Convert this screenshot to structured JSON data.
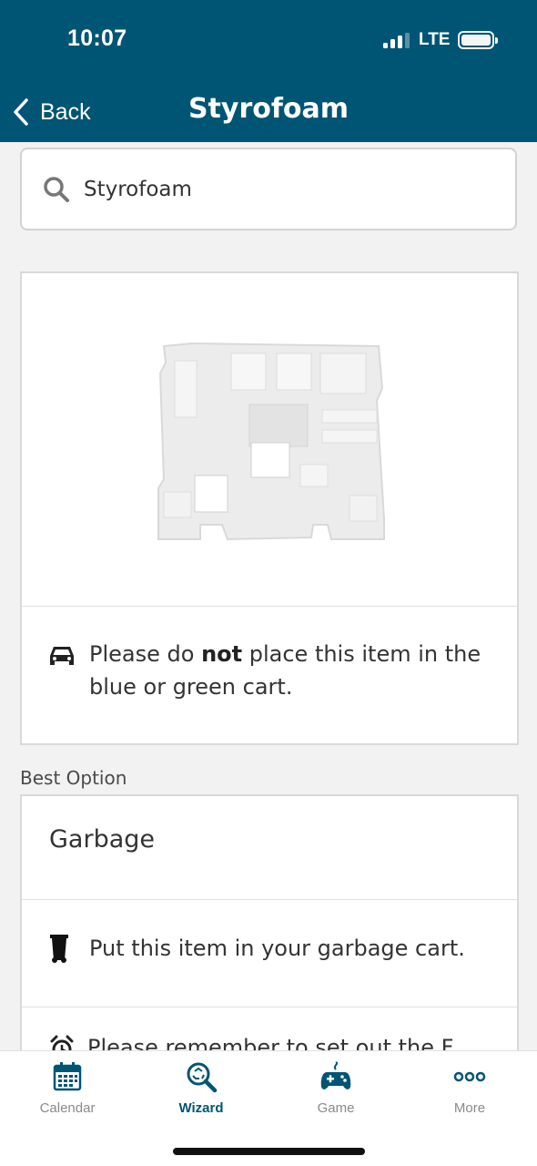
{
  "status_bar": {
    "time": "10:07",
    "network": "LTE"
  },
  "header": {
    "back_label": "Back",
    "title": "Styrofoam"
  },
  "search": {
    "value": "Styrofoam",
    "icon": "search-icon"
  },
  "item_card": {
    "notice_prefix": "Please do ",
    "notice_bold": "not",
    "notice_suffix": " place this item in the blue or green cart.",
    "notice_icon": "car-icon"
  },
  "best_option": {
    "section_label": "Best Option",
    "title": "Garbage",
    "instruction": "Put this item in your garbage cart.",
    "instruction_icon": "garbage-bin-icon",
    "cutoff_text": "Please remember to set out the F...",
    "cutoff_icon": "alarm-clock-icon"
  },
  "tabs": [
    {
      "label": "Calendar",
      "icon": "calendar-icon",
      "active": false
    },
    {
      "label": "Wizard",
      "icon": "wizard-search-icon",
      "active": true
    },
    {
      "label": "Game",
      "icon": "game-controller-icon",
      "active": false
    },
    {
      "label": "More",
      "icon": "more-dots-icon",
      "active": false
    }
  ],
  "colors": {
    "brand": "#005574",
    "inactive_tab": "#8a8a8a"
  }
}
